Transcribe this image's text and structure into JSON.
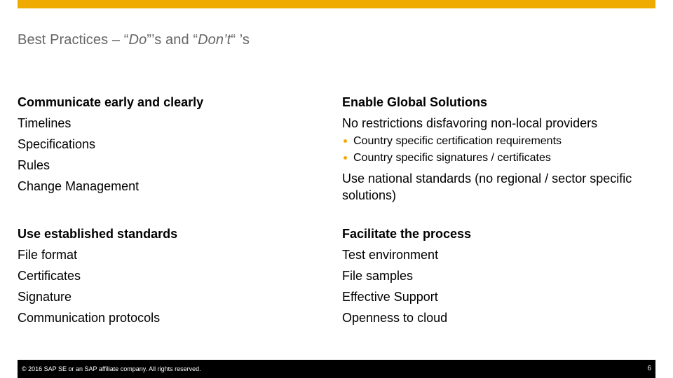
{
  "colors": {
    "accent": "#f0ab00",
    "title": "#666666",
    "footer_bg": "#000000",
    "bullet": "#f0ab00"
  },
  "title": {
    "part1": "Best Practices – “",
    "italic1": "Do",
    "part2": "”’s and “",
    "italic2": "Don’t",
    "part3": "“ ’s"
  },
  "sections": [
    {
      "heading": "Communicate early and clearly",
      "items": [
        "Timelines",
        "Specifications",
        "Rules",
        "Change Management"
      ]
    },
    {
      "heading": "Enable Global Solutions",
      "item1": "No restrictions disfavoring non-local providers",
      "bullets": [
        "Country specific certification requirements",
        "Country specific signatures / certificates"
      ],
      "item2": "Use national standards (no regional / sector specific solutions)"
    },
    {
      "heading": "Use established standards",
      "items": [
        "File format",
        "Certificates",
        "Signature",
        "Communication protocols"
      ]
    },
    {
      "heading": "Facilitate the process",
      "items": [
        "Test environment",
        "File samples",
        "Effective Support",
        "Openness to cloud"
      ]
    }
  ],
  "footer": {
    "copyright": "© 2016 SAP SE or an SAP affiliate company. All rights reserved.",
    "page_number": "6"
  }
}
